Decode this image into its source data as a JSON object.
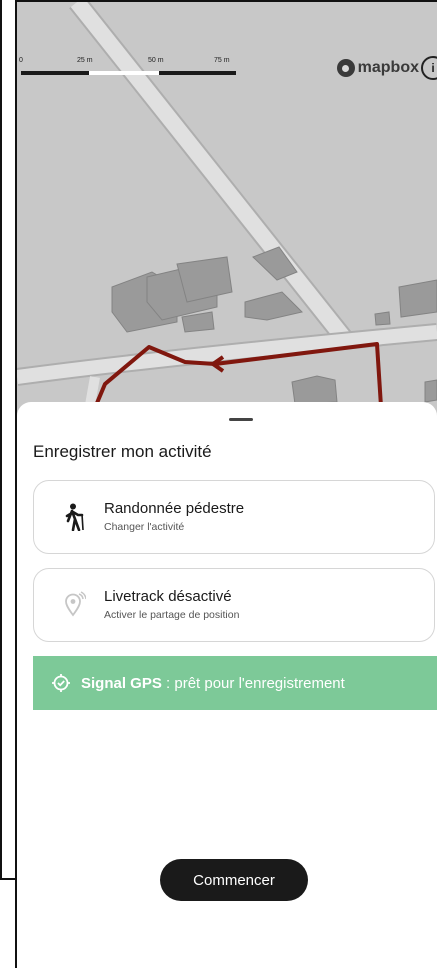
{
  "map": {
    "scale": {
      "labels": [
        "0",
        "25 m",
        "50 m",
        "75 m"
      ]
    },
    "attribution": {
      "logo_text": "mapbox",
      "info_glyph": "i"
    },
    "colors": {
      "background": "#d9d9d9",
      "road": "#f4f4f4",
      "building": "#a8a8a8",
      "track": "#8b1a10"
    }
  },
  "sheet": {
    "title": "Enregistrer mon activité",
    "activity_card": {
      "icon": "hiker-icon",
      "title": "Randonnée pédestre",
      "subtitle": "Changer l'activité"
    },
    "livetrack_card": {
      "icon": "location-broadcast-icon",
      "title": "Livetrack désactivé",
      "subtitle": "Activer le partage de position"
    },
    "gps_banner": {
      "icon": "gps-target-icon",
      "label": "Signal GPS",
      "status": " : prêt pour l'enregistrement",
      "color": "#7dc998"
    },
    "start_button_label": "Commencer"
  }
}
